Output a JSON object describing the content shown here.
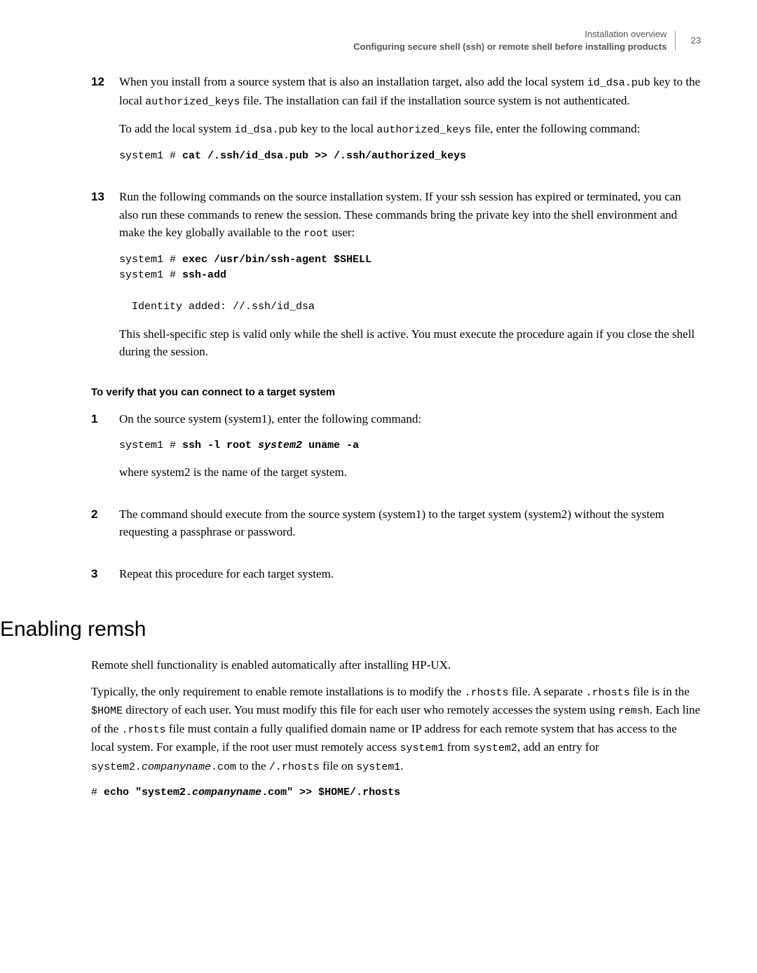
{
  "header": {
    "line1": "Installation overview",
    "line2": "Configuring secure shell (ssh) or remote shell before installing products",
    "page": "23"
  },
  "step12": {
    "num": "12",
    "p1a": "When you install from a source system that is also an installation target, also add the local system ",
    "c1": "id_dsa.pub",
    "p1b": " key to the local ",
    "c2": "authorized_keys",
    "p1c": " file. The installation can fail if the installation source system is not authenticated.",
    "p2a": "To add the local system ",
    "c3": "id_dsa.pub",
    "p2b": " key to the local ",
    "c4": "authorized_keys",
    "p2c": " file, enter the following command:",
    "code_p": "system1 # ",
    "code_b": "cat /.ssh/id_dsa.pub >> /.ssh/authorized_keys"
  },
  "step13": {
    "num": "13",
    "p1a": "Run the following commands on the source installation system. If your ssh session has expired or terminated, you can also run these commands to renew the session. These commands bring the private key into the shell environment and make the key globally available to the ",
    "c1": "root",
    "p1b": " user:",
    "l1p": "system1 # ",
    "l1b": "exec /usr/bin/ssh-agent $SHELL",
    "l2p": "system1 # ",
    "l2b": "ssh-add",
    "l3": "  Identity added: //.ssh/id_dsa",
    "p2": "This shell-specific step is valid only while the shell is active. You must execute the procedure again if you close the shell during the session."
  },
  "verify": {
    "heading": "To verify that you can connect to a target system",
    "s1": {
      "num": "1",
      "p1": "On the source system (system1), enter the following command:",
      "cp": "system1 # ",
      "cb1": "ssh -l root ",
      "ci": "system2",
      "cb2": " uname -a",
      "p2": "where system2 is the name of the target system."
    },
    "s2": {
      "num": "2",
      "p1": "The command should execute from the source system (system1) to the target system (system2) without the system requesting a passphrase or password."
    },
    "s3": {
      "num": "3",
      "p1": "Repeat this procedure for each target system."
    }
  },
  "remsh": {
    "heading": "Enabling remsh",
    "p1": "Remote shell functionality is enabled automatically after installing HP-UX.",
    "p2a": "Typically, the only requirement to enable remote installations is to modify the ",
    "c1": ".rhosts",
    "p2b": " file. A separate ",
    "c2": ".rhosts",
    "p2c": " file is in the ",
    "c3": "$HOME",
    "p2d": " directory of each user. You must modify this file for each user who remotely accesses the system using ",
    "c4": "remsh",
    "p2e": ". Each line of the ",
    "c5": ".rhosts",
    "p2f": " file must contain a fully qualified domain name or IP address for each remote system that has access to the local system. For example, if the root user must remotely access ",
    "c6": "system1",
    "p2g": " from ",
    "c7": "system2",
    "p2h": ", add an entry for ",
    "c8a": "system2.",
    "c8i": "companyname",
    "c8b": ".com",
    "p2i": " to the ",
    "c9": "/.rhosts",
    "p2j": " file on ",
    "c10": "system1",
    "p2k": ".",
    "code_p": "# ",
    "code_b1": "echo \"system2.",
    "code_i": "companyname",
    "code_b2": ".com\" >> $HOME/.rhosts"
  }
}
